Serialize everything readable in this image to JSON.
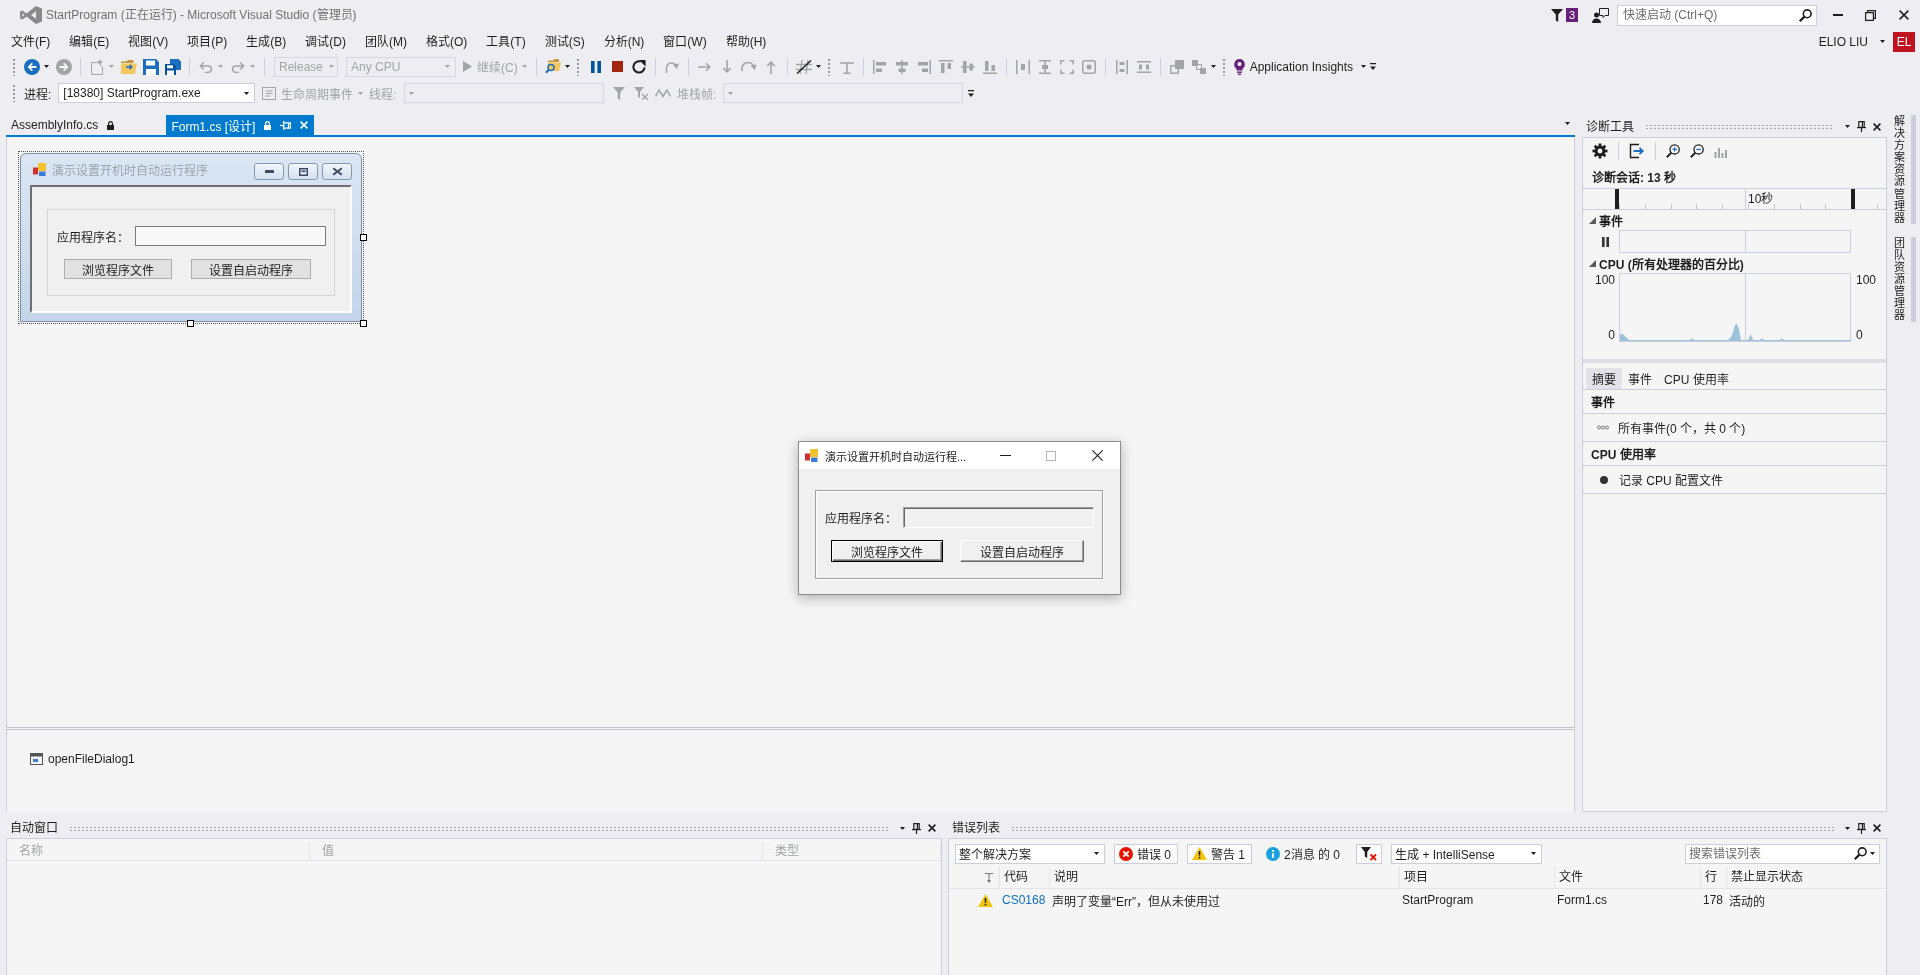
{
  "window": {
    "title": "StartProgram (正在运行) - Microsoft Visual Studio (管理员)",
    "notifications": "3",
    "quick_launch": {
      "placeholder": "快速启动 (Ctrl+Q)"
    },
    "user": {
      "name": "ELIO LIU",
      "initials": "EL"
    }
  },
  "menu": [
    "文件(F)",
    "编辑(E)",
    "视图(V)",
    "项目(P)",
    "生成(B)",
    "调试(D)",
    "团队(M)",
    "格式(O)",
    "工具(T)",
    "测试(S)",
    "分析(N)",
    "窗口(W)",
    "帮助(H)"
  ],
  "standard_toolbar": {
    "configuration": {
      "value": "Release",
      "disabled": true
    },
    "platform": {
      "value": "Any CPU",
      "disabled": true
    },
    "continue_button": {
      "label": "继续(C)",
      "disabled": true
    },
    "insights_button": {
      "label": "Application Insights"
    }
  },
  "debug_location_toolbar": {
    "process": {
      "label": "进程:",
      "value": "[18380] StartProgram.exe"
    },
    "lifecycle_events": {
      "label": "生命周期事件",
      "disabled": true
    },
    "thread": {
      "label": "线程:",
      "disabled": true
    },
    "stack_frame": {
      "label": "堆栈帧:",
      "disabled": true
    }
  },
  "document_tabs": [
    {
      "label": "AssemblyInfo.cs",
      "selected": false
    },
    {
      "label": "Form1.cs [设计]",
      "selected": true
    }
  ],
  "designer": {
    "form": {
      "title": "演示设置开机时自动运行程序",
      "label": "应用程序名：",
      "buttons": [
        "浏览程序文件",
        "设置自启动程序"
      ]
    },
    "component_tray": [
      "openFileDialog1"
    ]
  },
  "running_app": {
    "title": "演示设置开机时自动运行程...",
    "label": "应用程序名：",
    "buttons": [
      {
        "label": "浏览程序文件",
        "default": true
      },
      {
        "label": "设置自启动程序",
        "default": false
      }
    ]
  },
  "diagnostics": {
    "title": "诊断工具",
    "session": "诊断会话: 13 秒",
    "timeline_label": "10秒",
    "events_track": {
      "heading": "事件",
      "expanded": true
    },
    "cpu_track": {
      "heading": "CPU (所有处理器的百分比)",
      "expanded": true,
      "left_max": "100",
      "left_min": "0",
      "right_max": "100",
      "right_min": "0"
    },
    "tabs": [
      {
        "label": "摘要",
        "selected": true
      },
      {
        "label": "事件",
        "selected": false
      },
      {
        "label": "CPU 使用率",
        "selected": false
      }
    ],
    "sections": [
      {
        "heading": "事件",
        "items": [
          {
            "kind": "events",
            "label": "所有事件(0 个，共 0 个)"
          }
        ]
      },
      {
        "heading": "CPU 使用率",
        "items": [
          {
            "kind": "record",
            "label": "记录 CPU 配置文件"
          }
        ]
      }
    ]
  },
  "side_tabs": [
    "解决方案资源管理器",
    "团队资源管理器"
  ],
  "autos": {
    "title": "自动窗口",
    "columns": [
      "名称",
      "值",
      "类型"
    ]
  },
  "error_list": {
    "title": "错误列表",
    "scope": "整个解决方案",
    "filters": [
      {
        "kind": "error",
        "label": "错误 0",
        "selected": true
      },
      {
        "kind": "warning",
        "label": "警告 1",
        "selected": true
      },
      {
        "kind": "message",
        "label": "2消息 的 0",
        "selected": false
      }
    ],
    "source": "生成 + IntelliSense",
    "search": {
      "placeholder": "搜索错误列表"
    },
    "columns": [
      "代码",
      "说明",
      "项目",
      "文件",
      "行",
      "禁止显示状态"
    ],
    "rows": [
      {
        "kind": "warning",
        "code": "CS0168",
        "description": "声明了变量“Err”，但从未使用过",
        "project": "StartProgram",
        "file": "Form1.cs",
        "line": "178",
        "suppression": "活动的"
      }
    ]
  }
}
